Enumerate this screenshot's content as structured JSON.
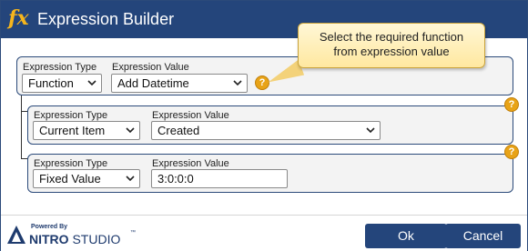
{
  "dialog": {
    "title": "Expression Builder",
    "icon": "fx-icon"
  },
  "callout": {
    "line1": "Select the required function",
    "line2": "from expression value"
  },
  "rows": [
    {
      "type_label": "Expression Type",
      "type_value": "Function",
      "value_label": "Expression Value",
      "value": "Add Datetime",
      "value_kind": "select"
    },
    {
      "type_label": "Expression Type",
      "type_value": "Current Item",
      "value_label": "Expression Value",
      "value": "Created",
      "value_kind": "select"
    },
    {
      "type_label": "Expression Type",
      "type_value": "Fixed Value",
      "value_label": "Expression Value",
      "value": "3:0:0:0",
      "value_kind": "input"
    }
  ],
  "help": {
    "glyph": "?"
  },
  "footer": {
    "powered_by": "Powered By",
    "brand_bold": "NITRO",
    "brand_light": "STUDIO",
    "trademark": "™",
    "ok_label": "Ok",
    "cancel_label": "Cancel"
  },
  "colors": {
    "titlebar": "#24457b",
    "accent": "#e8a317",
    "button": "#24457b"
  }
}
